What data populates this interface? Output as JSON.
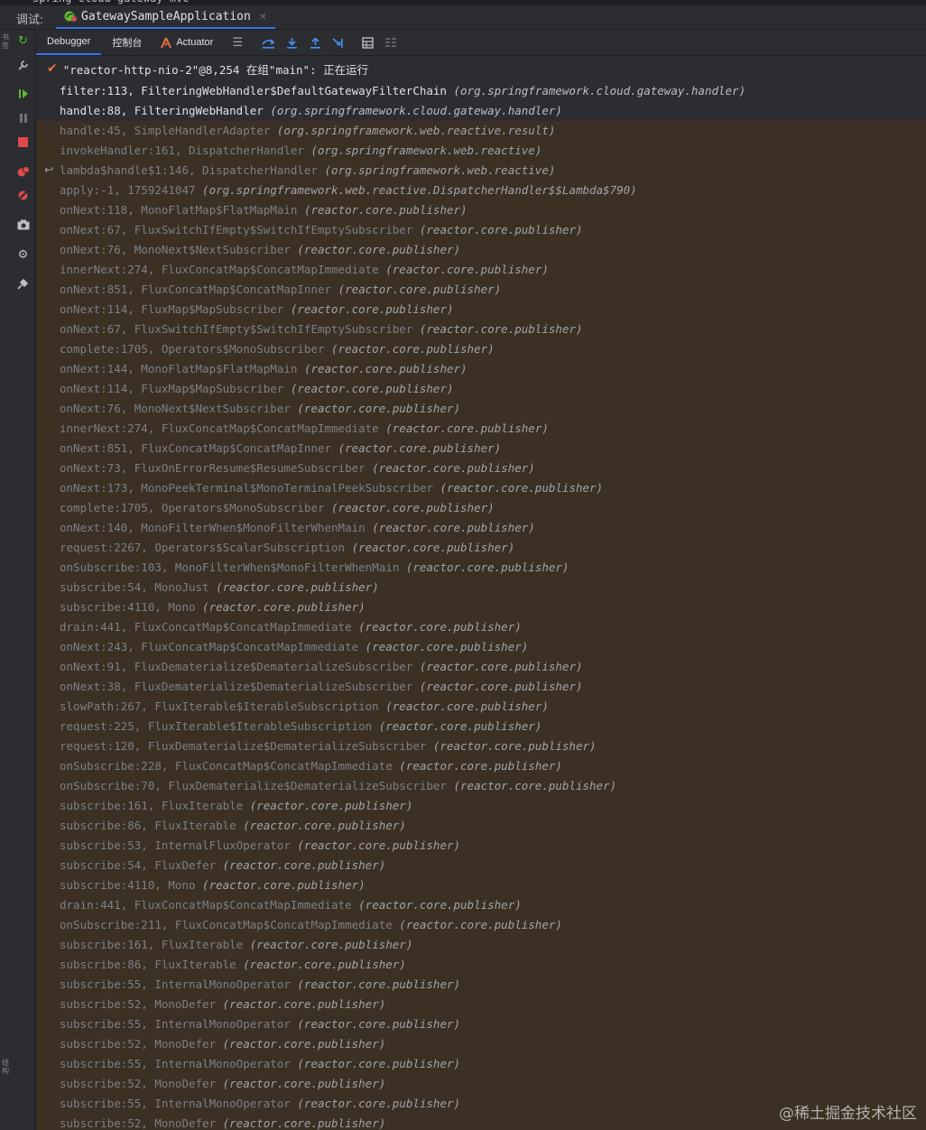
{
  "top_strip": {
    "project_label": "spring-cloud-gateway-mvc"
  },
  "title_bar": {
    "label": "调试:",
    "tab_label": "GatewaySampleApplication",
    "close_glyph": "×"
  },
  "left_strip": {
    "text1": "书签",
    "text2": "结构"
  },
  "toolbar": {
    "tabs": [
      "Debugger",
      "控制台",
      "Actuator"
    ],
    "icons": [
      "menu-icon",
      "show-execution-point-icon",
      "step-over-icon",
      "step-out-icon",
      "step-into-icon",
      "run-to-cursor-icon",
      "evaluate-expression-icon",
      "trace-icon"
    ]
  },
  "side_icons": [
    "rerun-icon",
    "settings-wrench-icon",
    "resume-icon",
    "pause-icon",
    "stop-icon",
    "view-breakpoints-icon",
    "mute-breakpoints-icon",
    "camera-icon",
    "gear-icon",
    "pin-icon"
  ],
  "colors": {
    "accent": "#3574f0",
    "run": "#5fb832",
    "stop": "#e0484a",
    "frame_bg": "#3b3023"
  },
  "thread": {
    "label": "\"reactor-http-nio-2\"@8,254 在组\"main\": 正在运行"
  },
  "frames": [
    {
      "name": "filter:113, FilteringWebHandler$DefaultGatewayFilterChain",
      "pkg": "(org.springframework.cloud.gateway.handler)"
    },
    {
      "name": "handle:88, FilteringWebHandler",
      "pkg": "(org.springframework.cloud.gateway.handler)"
    },
    {
      "name": "handle:45, SimpleHandlerAdapter",
      "pkg": "(org.springframework.web.reactive.result)"
    },
    {
      "name": "invokeHandler:161, DispatcherHandler",
      "pkg": "(org.springframework.web.reactive)"
    },
    {
      "name": "lambda$handle$1:146, DispatcherHandler",
      "pkg": "(org.springframework.web.reactive)"
    },
    {
      "name": "apply:-1, 1759241047",
      "pkg": "(org.springframework.web.reactive.DispatcherHandler$$Lambda$790)"
    },
    {
      "name": "onNext:118, MonoFlatMap$FlatMapMain",
      "pkg": "(reactor.core.publisher)"
    },
    {
      "name": "onNext:67, FluxSwitchIfEmpty$SwitchIfEmptySubscriber",
      "pkg": "(reactor.core.publisher)"
    },
    {
      "name": "onNext:76, MonoNext$NextSubscriber",
      "pkg": "(reactor.core.publisher)"
    },
    {
      "name": "innerNext:274, FluxConcatMap$ConcatMapImmediate",
      "pkg": "(reactor.core.publisher)"
    },
    {
      "name": "onNext:851, FluxConcatMap$ConcatMapInner",
      "pkg": "(reactor.core.publisher)"
    },
    {
      "name": "onNext:114, FluxMap$MapSubscriber",
      "pkg": "(reactor.core.publisher)"
    },
    {
      "name": "onNext:67, FluxSwitchIfEmpty$SwitchIfEmptySubscriber",
      "pkg": "(reactor.core.publisher)"
    },
    {
      "name": "complete:1705, Operators$MonoSubscriber",
      "pkg": "(reactor.core.publisher)"
    },
    {
      "name": "onNext:144, MonoFlatMap$FlatMapMain",
      "pkg": "(reactor.core.publisher)"
    },
    {
      "name": "onNext:114, FluxMap$MapSubscriber",
      "pkg": "(reactor.core.publisher)"
    },
    {
      "name": "onNext:76, MonoNext$NextSubscriber",
      "pkg": "(reactor.core.publisher)"
    },
    {
      "name": "innerNext:274, FluxConcatMap$ConcatMapImmediate",
      "pkg": "(reactor.core.publisher)"
    },
    {
      "name": "onNext:851, FluxConcatMap$ConcatMapInner",
      "pkg": "(reactor.core.publisher)"
    },
    {
      "name": "onNext:73, FluxOnErrorResume$ResumeSubscriber",
      "pkg": "(reactor.core.publisher)"
    },
    {
      "name": "onNext:173, MonoPeekTerminal$MonoTerminalPeekSubscriber",
      "pkg": "(reactor.core.publisher)"
    },
    {
      "name": "complete:1705, Operators$MonoSubscriber",
      "pkg": "(reactor.core.publisher)"
    },
    {
      "name": "onNext:140, MonoFilterWhen$MonoFilterWhenMain",
      "pkg": "(reactor.core.publisher)"
    },
    {
      "name": "request:2267, Operators$ScalarSubscription",
      "pkg": "(reactor.core.publisher)"
    },
    {
      "name": "onSubscribe:103, MonoFilterWhen$MonoFilterWhenMain",
      "pkg": "(reactor.core.publisher)"
    },
    {
      "name": "subscribe:54, MonoJust",
      "pkg": "(reactor.core.publisher)"
    },
    {
      "name": "subscribe:4110, Mono",
      "pkg": "(reactor.core.publisher)"
    },
    {
      "name": "drain:441, FluxConcatMap$ConcatMapImmediate",
      "pkg": "(reactor.core.publisher)"
    },
    {
      "name": "onNext:243, FluxConcatMap$ConcatMapImmediate",
      "pkg": "(reactor.core.publisher)"
    },
    {
      "name": "onNext:91, FluxDematerialize$DematerializeSubscriber",
      "pkg": "(reactor.core.publisher)"
    },
    {
      "name": "onNext:38, FluxDematerialize$DematerializeSubscriber",
      "pkg": "(reactor.core.publisher)"
    },
    {
      "name": "slowPath:267, FluxIterable$IterableSubscription",
      "pkg": "(reactor.core.publisher)"
    },
    {
      "name": "request:225, FluxIterable$IterableSubscription",
      "pkg": "(reactor.core.publisher)"
    },
    {
      "name": "request:120, FluxDematerialize$DematerializeSubscriber",
      "pkg": "(reactor.core.publisher)"
    },
    {
      "name": "onSubscribe:228, FluxConcatMap$ConcatMapImmediate",
      "pkg": "(reactor.core.publisher)"
    },
    {
      "name": "onSubscribe:70, FluxDematerialize$DematerializeSubscriber",
      "pkg": "(reactor.core.publisher)"
    },
    {
      "name": "subscribe:161, FluxIterable",
      "pkg": "(reactor.core.publisher)"
    },
    {
      "name": "subscribe:86, FluxIterable",
      "pkg": "(reactor.core.publisher)"
    },
    {
      "name": "subscribe:53, InternalFluxOperator",
      "pkg": "(reactor.core.publisher)"
    },
    {
      "name": "subscribe:54, FluxDefer",
      "pkg": "(reactor.core.publisher)"
    },
    {
      "name": "subscribe:4110, Mono",
      "pkg": "(reactor.core.publisher)"
    },
    {
      "name": "drain:441, FluxConcatMap$ConcatMapImmediate",
      "pkg": "(reactor.core.publisher)"
    },
    {
      "name": "onSubscribe:211, FluxConcatMap$ConcatMapImmediate",
      "pkg": "(reactor.core.publisher)"
    },
    {
      "name": "subscribe:161, FluxIterable",
      "pkg": "(reactor.core.publisher)"
    },
    {
      "name": "subscribe:86, FluxIterable",
      "pkg": "(reactor.core.publisher)"
    },
    {
      "name": "subscribe:55, InternalMonoOperator",
      "pkg": "(reactor.core.publisher)"
    },
    {
      "name": "subscribe:52, MonoDefer",
      "pkg": "(reactor.core.publisher)"
    },
    {
      "name": "subscribe:55, InternalMonoOperator",
      "pkg": "(reactor.core.publisher)"
    },
    {
      "name": "subscribe:52, MonoDefer",
      "pkg": "(reactor.core.publisher)"
    },
    {
      "name": "subscribe:55, InternalMonoOperator",
      "pkg": "(reactor.core.publisher)"
    },
    {
      "name": "subscribe:52, MonoDefer",
      "pkg": "(reactor.core.publisher)"
    },
    {
      "name": "subscribe:55, InternalMonoOperator",
      "pkg": "(reactor.core.publisher)"
    },
    {
      "name": "subscribe:52, MonoDefer",
      "pkg": "(reactor.core.publisher)"
    }
  ],
  "watermark": "@稀土掘金技术社区"
}
